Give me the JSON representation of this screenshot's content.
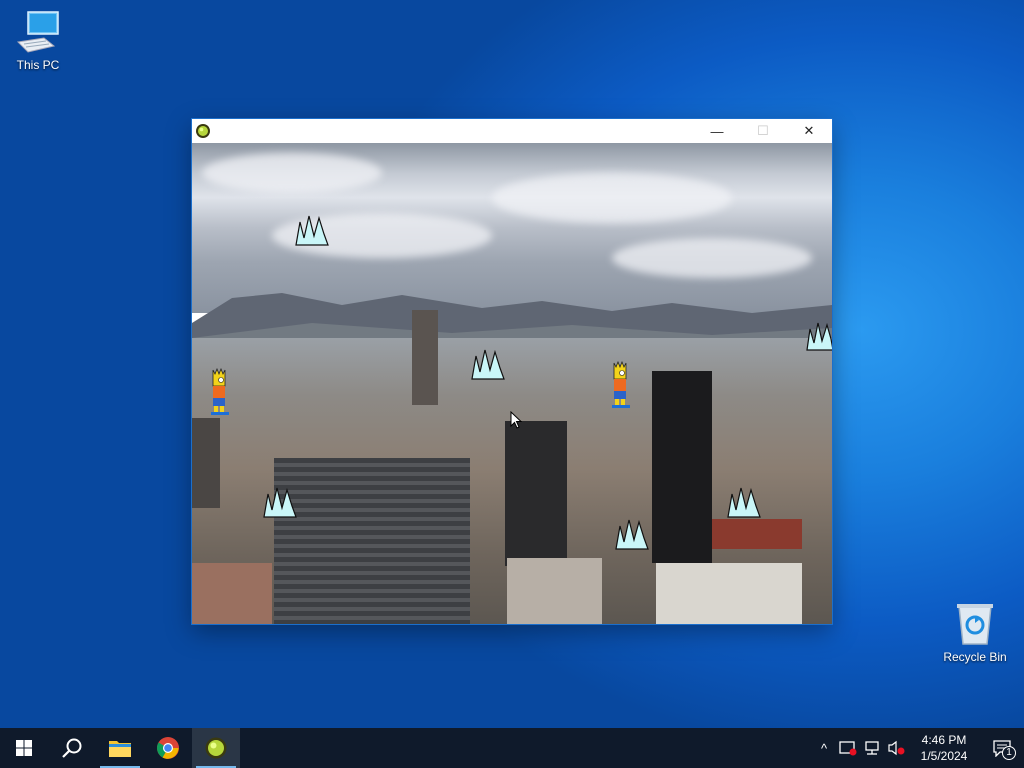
{
  "desktop": {
    "icons": [
      {
        "label": "This PC",
        "icon": "computer-icon"
      },
      {
        "label": "Recycle Bin",
        "icon": "recycle-bin-icon"
      }
    ]
  },
  "window": {
    "title": "",
    "app_icon": "green-orb-icon",
    "controls": {
      "minimize": "—",
      "maximize": "☐",
      "close": "✕"
    }
  },
  "game": {
    "characters": [
      "bart-simpson-sprite",
      "bart-simpson-sprite"
    ],
    "obstacles": [
      "spike-cluster",
      "spike-cluster",
      "spike-cluster",
      "spike-cluster",
      "spike-cluster",
      "spike-cluster",
      "spike-cluster"
    ],
    "background": "city-skyline-photo"
  },
  "taskbar": {
    "start": "windows-start-icon",
    "search": "search-icon",
    "pinned": [
      "file-explorer-icon",
      "chrome-icon",
      "green-orb-app-icon"
    ],
    "tray": {
      "chevron": "^",
      "time": "4:46 PM",
      "date": "1/5/2024",
      "notifications_count": "1"
    }
  },
  "colors": {
    "desktop_blue": "#0c5bc4",
    "taskbar": "#0f1a2b",
    "spike_fill": "#c9f6f8",
    "accent": "#76b9ed"
  }
}
